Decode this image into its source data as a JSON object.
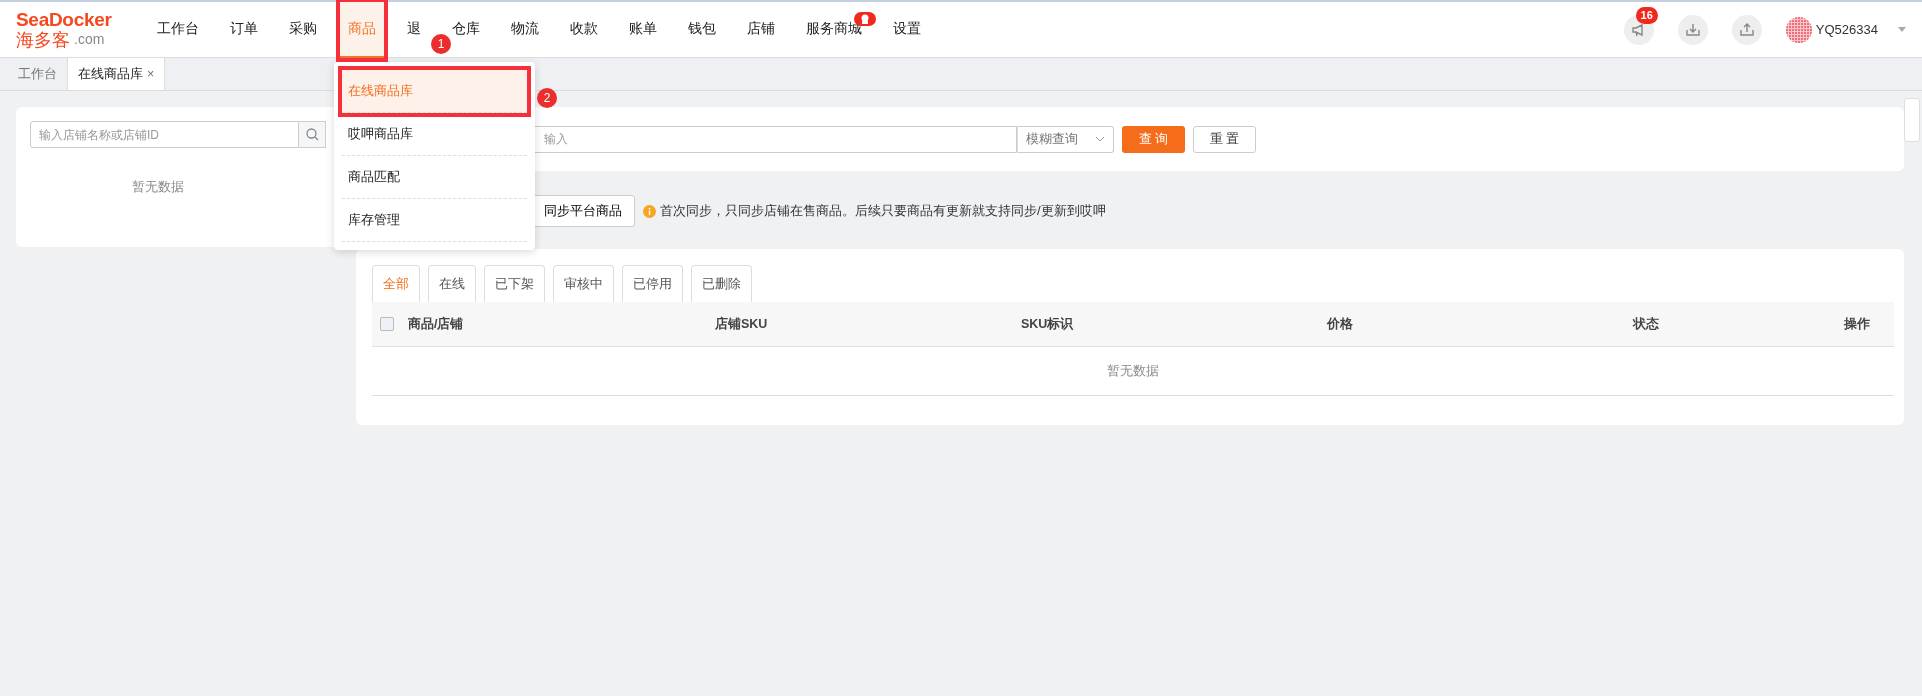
{
  "logo": {
    "brand": "SeaDocker",
    "cn": "海多客",
    "suffix": ".com"
  },
  "nav": [
    {
      "label": "工作台",
      "selected": false,
      "badge": false
    },
    {
      "label": "订单",
      "selected": false,
      "badge": false
    },
    {
      "label": "采购",
      "selected": false,
      "badge": false
    },
    {
      "label": "商品",
      "selected": true,
      "badge": false
    },
    {
      "label": "退",
      "selected": false,
      "badge": false
    },
    {
      "label": "仓库",
      "selected": false,
      "badge": false
    },
    {
      "label": "物流",
      "selected": false,
      "badge": false
    },
    {
      "label": "收款",
      "selected": false,
      "badge": false
    },
    {
      "label": "账单",
      "selected": false,
      "badge": false
    },
    {
      "label": "钱包",
      "selected": false,
      "badge": false
    },
    {
      "label": "店铺",
      "selected": false,
      "badge": false
    },
    {
      "label": "服务商城",
      "selected": false,
      "badge": true
    },
    {
      "label": "设置",
      "selected": false,
      "badge": false
    }
  ],
  "header_actions": {
    "notifications": "16",
    "username": "YQ526334"
  },
  "page_tabs": [
    {
      "label": "工作台",
      "selected": false
    },
    {
      "label": "在线商品库",
      "selected": true,
      "close": "×"
    }
  ],
  "dropdown": [
    {
      "label": "在线商品库",
      "selected": true
    },
    {
      "label": "哎呷商品库",
      "selected": false
    },
    {
      "label": "商品匹配",
      "selected": false
    },
    {
      "label": "库存管理",
      "selected": false
    }
  ],
  "annotations": [
    {
      "number": "1"
    },
    {
      "number": "2"
    }
  ],
  "store_search": {
    "placeholder": "输入店铺名称或店铺ID",
    "empty": "暂无数据"
  },
  "search": {
    "placeholder": "输入",
    "mode": "模糊查询",
    "query_button": "查 询",
    "reset_button": "重 置"
  },
  "sync": {
    "button": "同步平台商品",
    "hint": "首次同步，只同步店铺在售商品。后续只要商品有更新就支持同步/更新到哎呷"
  },
  "status_tabs": [
    {
      "label": "全部",
      "selected": true
    },
    {
      "label": "在线",
      "selected": false
    },
    {
      "label": "已下架",
      "selected": false
    },
    {
      "label": "审核中",
      "selected": false
    },
    {
      "label": "已停用",
      "selected": false
    },
    {
      "label": "已删除",
      "selected": false
    }
  ],
  "table": {
    "columns": [
      "商品/店铺",
      "店铺SKU",
      "SKU标识",
      "价格",
      "状态",
      "操作"
    ],
    "select_all_checked": false,
    "empty": "暂无数据"
  }
}
